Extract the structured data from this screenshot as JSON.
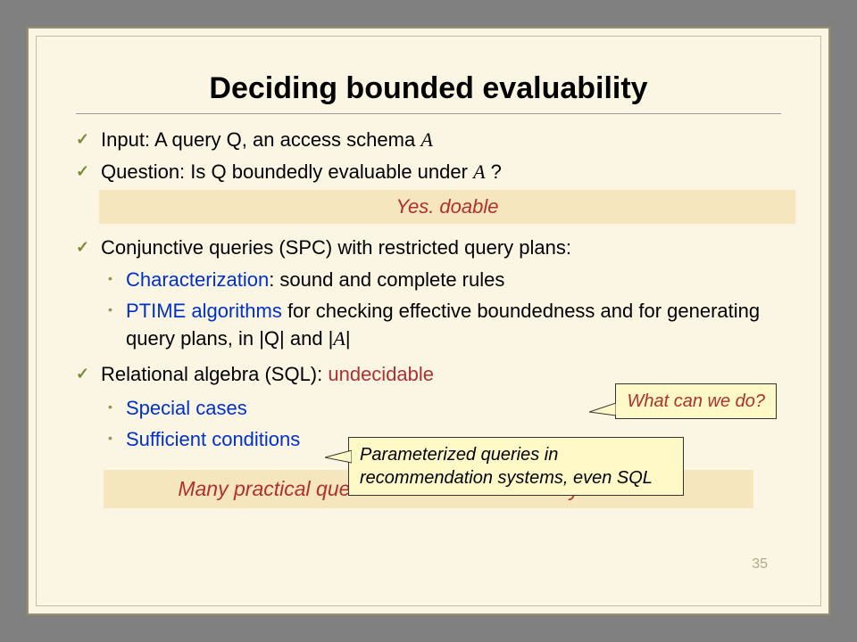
{
  "title": "Deciding bounded evaluability",
  "bullets": {
    "b1_pre": "Input: A query Q, an access schema ",
    "b1_a": "A",
    "b2_pre": "Question:  Is Q boundedly evaluable under ",
    "b2_a": "A",
    "b2_post": " ?"
  },
  "yesbox": "Yes. doable",
  "spc": {
    "head": "Conjunctive queries (SPC) with restricted query plans:",
    "c1_blue": "Characterization",
    "c1_rest": ": sound and complete rules",
    "c2_blue": "PTIME algorithms",
    "c2_rest": " for checking effective boundedness and for generating query plans, in |Q| and |",
    "c2_a": "A",
    "c2_post": "|"
  },
  "ra": {
    "head_pre": "Relational algebra (SQL): ",
    "head_red": "undecidable",
    "s1": "Special cases",
    "s2": "Sufficient conditions"
  },
  "callout1": "What can we do?",
  "callout2": "Parameterized queries in recommendation systems, even SQL",
  "bottom": "Many practical queries are in fact boundedly evaluable!",
  "pagenum": "35"
}
